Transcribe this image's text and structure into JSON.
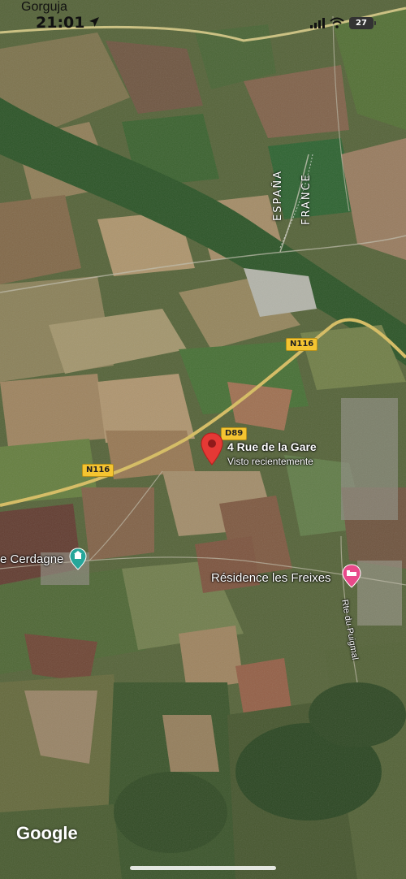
{
  "status_bar": {
    "place": "Gorguja",
    "time": "21:01",
    "battery_level": "27",
    "icons": [
      "location-arrow-icon",
      "signal-icon",
      "wifi-icon",
      "battery-icon"
    ]
  },
  "map": {
    "type": "satellite",
    "border_labels": [
      "ESPAÑA",
      "FRANCE"
    ],
    "roads": [
      "N116",
      "N116",
      "D89"
    ],
    "pin_label": "4 Rue de la Gare",
    "pin_sublabel": "Visto recientemente",
    "poi_1": "e Cerdagne",
    "poi_2": "Résidence les Freixes",
    "street_label": "Rte du Puigmal",
    "attribution": "Google",
    "colors": {
      "pin": "#e53935",
      "poi_teal": "#26a69a",
      "poi_pink": "#e84a8a",
      "road": "#f2d36b"
    }
  }
}
